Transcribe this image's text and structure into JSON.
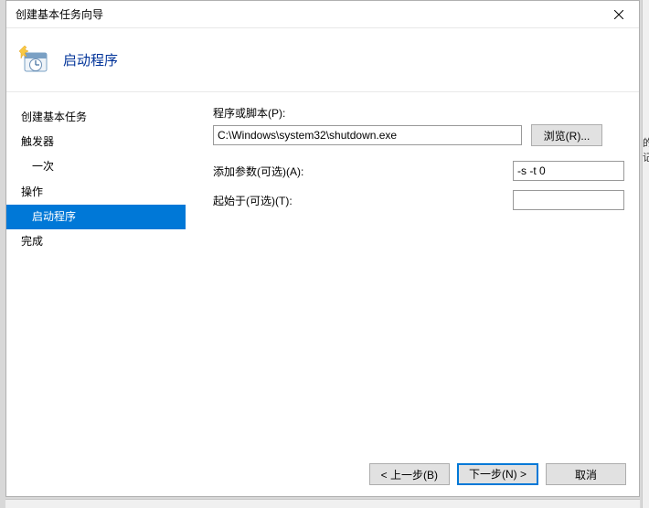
{
  "titlebar": {
    "title": "创建基本任务向导"
  },
  "header": {
    "heading": "启动程序"
  },
  "sidebar": {
    "items": [
      {
        "label": "创建基本任务",
        "sub": false,
        "selected": false
      },
      {
        "label": "触发器",
        "sub": false,
        "selected": false
      },
      {
        "label": "一次",
        "sub": true,
        "selected": false
      },
      {
        "label": "操作",
        "sub": false,
        "selected": false
      },
      {
        "label": "启动程序",
        "sub": true,
        "selected": true
      },
      {
        "label": "完成",
        "sub": false,
        "selected": false
      }
    ]
  },
  "form": {
    "program_label": "程序或脚本(P):",
    "program_value": "C:\\Windows\\system32\\shutdown.exe",
    "browse_label": "浏览(R)...",
    "args_label": "添加参数(可选)(A):",
    "args_value": "-s -t 0",
    "startin_label": "起始于(可选)(T):",
    "startin_value": ""
  },
  "footer": {
    "back": "< 上一步(B)",
    "next": "下一步(N) >",
    "cancel": "取消"
  },
  "peek": "的\n记"
}
